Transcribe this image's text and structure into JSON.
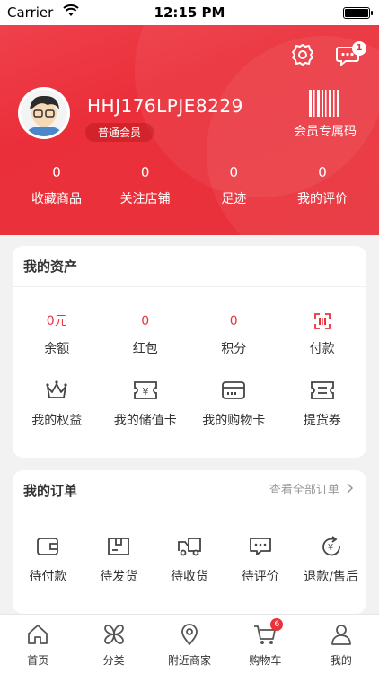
{
  "status_bar": {
    "carrier": "Carrier",
    "time": "12:15 PM"
  },
  "header": {
    "username": "HHJ176LPJE8229",
    "level": "普通会员",
    "member_code_label": "会员专属码",
    "message_badge": "1",
    "stats": [
      {
        "value": "0",
        "label": "收藏商品"
      },
      {
        "value": "0",
        "label": "关注店铺"
      },
      {
        "value": "0",
        "label": "足迹"
      },
      {
        "value": "0",
        "label": "我的评价"
      }
    ]
  },
  "assets": {
    "title": "我的资产",
    "row1": [
      {
        "value": "0元",
        "label": "余额"
      },
      {
        "value": "0",
        "label": "红包"
      },
      {
        "value": "0",
        "label": "积分"
      },
      {
        "label": "付款",
        "icon": "payment-code-icon"
      }
    ],
    "row2": [
      {
        "label": "我的权益",
        "icon": "crown-icon"
      },
      {
        "label": "我的储值卡",
        "icon": "stored-value-card-icon"
      },
      {
        "label": "我的购物卡",
        "icon": "shopping-card-icon"
      },
      {
        "label": "提货券",
        "icon": "coupon-icon"
      }
    ]
  },
  "orders": {
    "title": "我的订单",
    "view_all": "查看全部订单",
    "items": [
      {
        "label": "待付款",
        "icon": "wallet-icon"
      },
      {
        "label": "待发货",
        "icon": "box-icon"
      },
      {
        "label": "待收货",
        "icon": "truck-icon"
      },
      {
        "label": "待评价",
        "icon": "comment-icon"
      },
      {
        "label": "退款/售后",
        "icon": "refund-icon"
      }
    ]
  },
  "tabbar": {
    "items": [
      {
        "label": "首页",
        "icon": "home-icon"
      },
      {
        "label": "分类",
        "icon": "category-icon"
      },
      {
        "label": "附近商家",
        "icon": "location-icon"
      },
      {
        "label": "购物车",
        "icon": "cart-icon",
        "badge": "6"
      },
      {
        "label": "我的",
        "icon": "profile-icon"
      }
    ]
  },
  "colors": {
    "brand": "#e8323c",
    "background": "#f2f2f2"
  }
}
